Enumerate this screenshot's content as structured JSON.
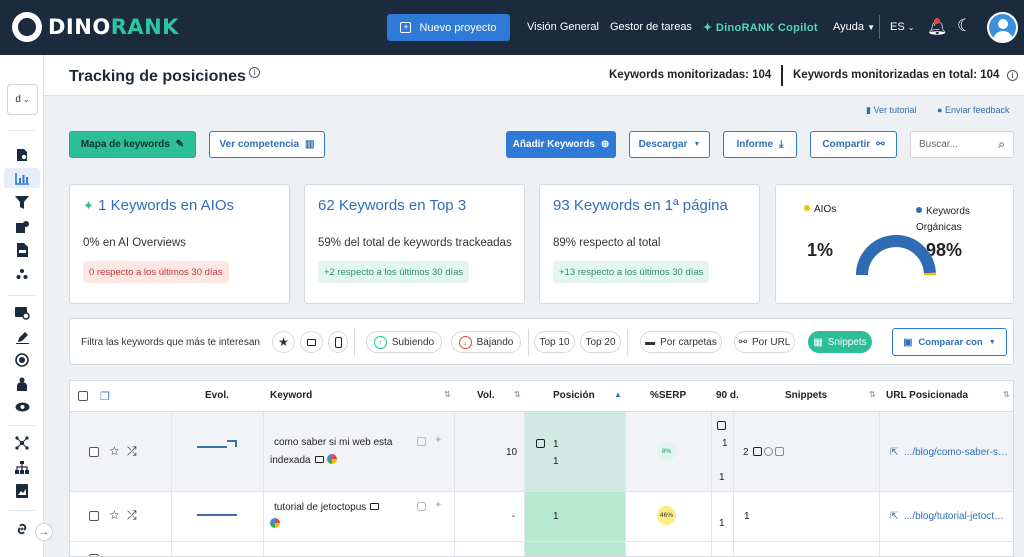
{
  "topbar": {
    "logo_dino": "DINO",
    "logo_rank": "RANK",
    "new_project": "Nuevo proyecto",
    "nav_overview": "Visión General",
    "nav_tasks": "Gestor de tareas",
    "nav_copilot": "DinoRANK Copilot",
    "nav_help": "Ayuda",
    "nav_lang": "ES"
  },
  "sidebar": {
    "dropdown_label": "d",
    "icons": [
      "document-search-icon",
      "chart-icon",
      "filter-icon",
      "puzzle-icon",
      "pdf-icon",
      "dots-icon",
      "image-search-icon",
      "pen-icon",
      "globe-icon",
      "person-icon",
      "eye-icon",
      "cluster-icon",
      "sitemap-icon",
      "image-report-icon",
      "link-icon"
    ]
  },
  "header": {
    "title": "Tracking de posiciones",
    "kw_monitored": "Keywords monitorizadas: 104",
    "kw_monitored_total": "Keywords monitorizadas en total: 104",
    "tutorial": "Ver tutorial",
    "feedback": "Enviar feedback"
  },
  "toolbar": {
    "keyword_map": "Mapa de keywords",
    "competition": "Ver competencia",
    "add_keywords": "Añadir Keywords",
    "download": "Descargar",
    "report": "Informe",
    "share": "Compartir",
    "search_placeholder": "Buscar..."
  },
  "cards": [
    {
      "title_num": "1",
      "title_text": "Keywords en AIOs",
      "line": "0% en AI Overviews",
      "chip": "0 respecto a los últimos 30 días"
    },
    {
      "title_num": "62",
      "title_text": "Keywords en Top 3",
      "line": "59% del total de keywords trackeadas",
      "chip": "+2 respecto a los últimos 30 días"
    },
    {
      "title_num": "93",
      "title_text": "Keywords en 1ª página",
      "line": "89% respecto al total",
      "chip": "+13 respecto a los últimos 30 días"
    }
  ],
  "donut": {
    "legend_aio": "AIOs",
    "legend_organic": "Keywords Orgánicas",
    "pct_aio": "1%",
    "pct_organic": "98%",
    "aio_color": "#f2c400",
    "organic_color": "#2e6cb6",
    "organic_fraction": 0.98
  },
  "filters": {
    "label": "Filtra las keywords que más te interesan",
    "rising": "Subiendo",
    "falling": "Bajando",
    "top10": "Top 10",
    "top20": "Top 20",
    "folders": "Por carpetas",
    "by_url": "Por URL",
    "snippets": "Snippets",
    "compare": "Comparar con"
  },
  "table": {
    "headers": {
      "evol": "Evol.",
      "keyword": "Keyword",
      "vol": "Vol.",
      "position": "Posición",
      "serp": "%SERP",
      "d90": "90 d.",
      "snippets": "Snippets",
      "url": "URL Posicionada"
    },
    "rows": [
      {
        "keyword_line1": "como saber si mi web esta",
        "keyword_line2": "indexada",
        "vol": "10",
        "pos_a": "1",
        "pos_b": "1",
        "serp": "8%",
        "d90_a": "1",
        "d90_b": "1",
        "snippets": "2",
        "url": ".../blog/como-saber-si-mi-web-esta-indexada"
      },
      {
        "keyword_line1": "tutorial de jetoctopus",
        "keyword_line2": "",
        "vol": "-",
        "pos_a": "1",
        "pos_b": "",
        "serp": "46%",
        "d90_a": "1",
        "d90_b": "",
        "snippets": "1",
        "url": ".../blog/tutorial-jetoctopus"
      }
    ]
  }
}
